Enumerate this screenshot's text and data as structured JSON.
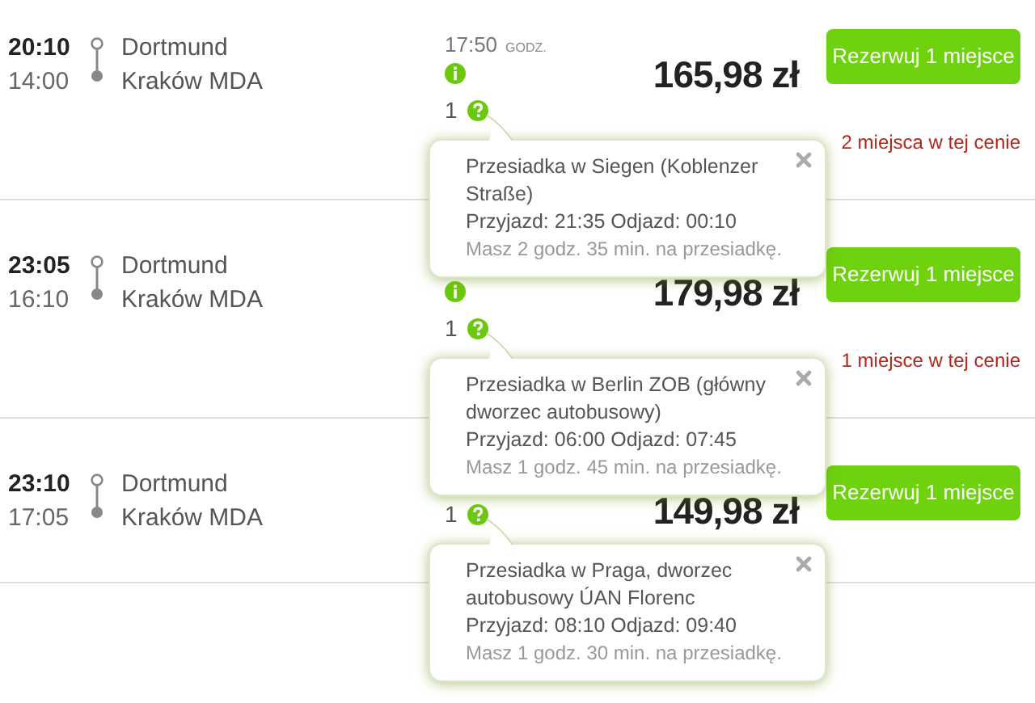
{
  "trips": [
    {
      "depart_time": "20:10",
      "arrive_time": "14:00",
      "from": "Dortmund",
      "to": "Kraków MDA",
      "duration": "17:50",
      "duration_unit": "GODZ.",
      "info_icon": true,
      "changes": "1",
      "price": "165,98 zł",
      "button": "Rezerwuj 1 miejsce",
      "seats_note": "2 miejsca w tej cenie",
      "transfer": {
        "title": "Przesiadka w Siegen (Koblenzer Straße)",
        "times": "Przyjazd: 21:35 Odjazd: 00:10",
        "wait": "Masz 2 godz. 35 min. na przesiadkę."
      }
    },
    {
      "depart_time": "23:05",
      "arrive_time": "16:10",
      "from": "Dortmund",
      "to": "Kraków MDA",
      "info_icon": true,
      "changes": "1",
      "price": "179,98 zł",
      "button": "Rezerwuj 1 miejsce",
      "seats_note": "1 miejsce w tej cenie",
      "transfer": {
        "title": "Przesiadka w Berlin ZOB (główny dworzec autobusowy)",
        "times": "Przyjazd: 06:00 Odjazd: 07:45",
        "wait": "Masz 1 godz. 45 min. na przesiadkę."
      }
    },
    {
      "depart_time": "23:10",
      "arrive_time": "17:05",
      "from": "Dortmund",
      "to": "Kraków MDA",
      "info_icon": false,
      "changes": "1",
      "price": "149,98 zł",
      "button": "Rezerwuj 1 miejsce",
      "transfer": {
        "title": "Przesiadka w Praga, dworzec autobusowy ÚAN Florenc",
        "times": "Przyjazd: 08:10 Odjazd: 09:40",
        "wait": "Masz 1 godz. 30 min. na przesiadkę."
      }
    }
  ]
}
